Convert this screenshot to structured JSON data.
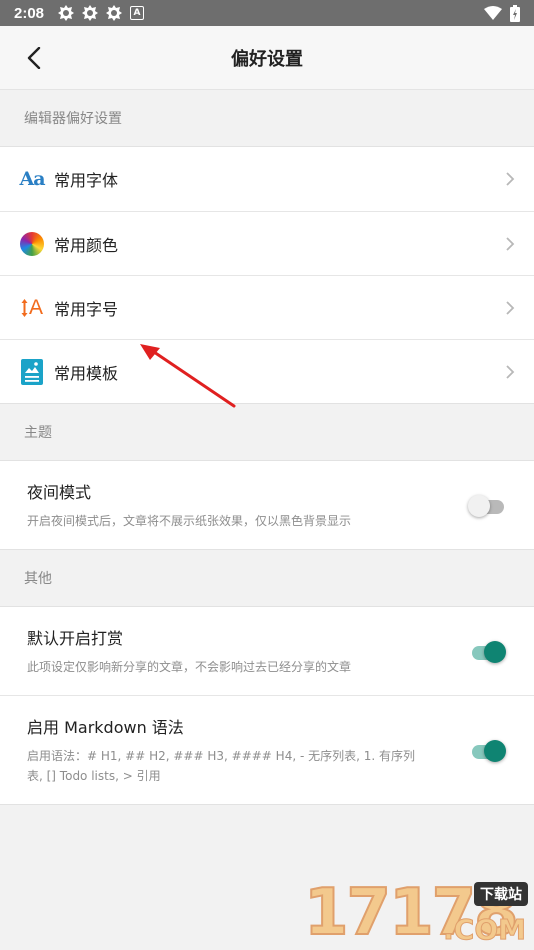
{
  "status_bar": {
    "time": "2:08",
    "icons": [
      "gear-icon",
      "gear-icon",
      "gear-icon",
      "a-badge-icon"
    ],
    "a_badge": "A",
    "right_icons": [
      "wifi-icon",
      "battery-icon"
    ]
  },
  "header": {
    "title": "偏好设置",
    "back_icon": "back-arrow-icon"
  },
  "sections": {
    "editor": {
      "label": "编辑器偏好设置",
      "items": [
        {
          "label": "常用字体",
          "icon": "font-aa-icon",
          "icon_text": "Aa"
        },
        {
          "label": "常用颜色",
          "icon": "color-wheel-icon"
        },
        {
          "label": "常用字号",
          "icon": "font-size-icon",
          "icon_text": "A"
        },
        {
          "label": "常用模板",
          "icon": "template-icon"
        }
      ]
    },
    "theme": {
      "label": "主题",
      "night_mode": {
        "title": "夜间模式",
        "desc": "开启夜间模式后，文章将不展示纸张效果，仅以黑色背景显示",
        "enabled": false
      }
    },
    "other": {
      "label": "其他",
      "reward": {
        "title": "默认开启打赏",
        "desc": "此项设定仅影响新分享的文章，不会影响过去已经分享的文章",
        "enabled": true
      },
      "markdown": {
        "title": "启用 Markdown 语法",
        "desc": "启用语法：# H1, ## H2, ### H3, #### H4, - 无序列表, 1. 有序列表, [] Todo lists, > 引用",
        "enabled": true
      }
    }
  },
  "colors": {
    "accent": "#0f8472",
    "accent_track": "#87c8bd",
    "aa_icon": "#2a7fc4",
    "size_icon": "#f26b1d",
    "template_icon": "#1aa3c8",
    "arrow": "#e02020"
  },
  "watermark": {
    "digits": "17178",
    "tag": "下载站",
    "domain": ".COM"
  }
}
